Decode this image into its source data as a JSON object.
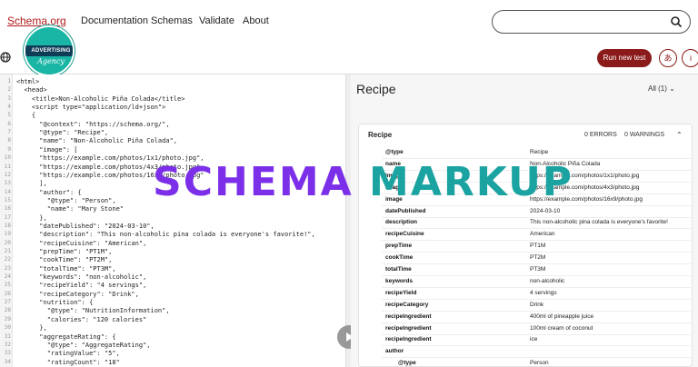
{
  "nav": {
    "logo": "Schema.org",
    "links": [
      "Documentation",
      "Schemas",
      "Validate",
      "About"
    ],
    "search_placeholder": ""
  },
  "badge": {
    "ribbon": "ADVERTISING",
    "script": "Agency"
  },
  "toolbar": {
    "run_label": "Run new test",
    "lang_label": "あ",
    "info_label": "i"
  },
  "editor": {
    "lines": [
      "<html>",
      "  <head>",
      "    <title>Non-Alcoholic Piña Colada</title>",
      "    <script type=\"application/ld+json\">",
      "    {",
      "      \"@context\": \"https://schema.org/\",",
      "      \"@type\": \"Recipe\",",
      "      \"name\": \"Non-Alcoholic Piña Colada\",",
      "      \"image\": [",
      "      \"https://example.com/photos/1x1/photo.jpg\",",
      "      \"https://example.com/photos/4x3/photo.jpg\",",
      "      \"https://example.com/photos/16x9/photo.jpg\"",
      "      ],",
      "      \"author\": {",
      "        \"@type\": \"Person\",",
      "        \"name\": \"Mary Stone\"",
      "      },",
      "      \"datePublished\": \"2024-03-10\",",
      "      \"description\": \"This non-alcoholic pina colada is everyone's favorite!\",",
      "      \"recipeCuisine\": \"American\",",
      "      \"prepTime\": \"PT1M\",",
      "      \"cookTime\": \"PT2M\",",
      "      \"totalTime\": \"PT3M\",",
      "      \"keywords\": \"non-alcoholic\",",
      "      \"recipeYield\": \"4 servings\",",
      "      \"recipeCategory\": \"Drink\",",
      "      \"nutrition\": {",
      "        \"@type\": \"NutritionInformation\",",
      "        \"calories\": \"120 calories\"",
      "      },",
      "      \"aggregateRating\": {",
      "        \"@type\": \"AggregateRating\",",
      "        \"ratingValue\": \"5\",",
      "        \"ratingCount\": \"18\""
    ]
  },
  "result": {
    "title": "Recipe",
    "filter": "All (1)",
    "card_title": "Recipe",
    "errors": "0 ERRORS",
    "warnings": "0 WARNINGS",
    "rows": [
      {
        "k": "@type",
        "v": "Recipe"
      },
      {
        "k": "name",
        "v": "Non-Alcoholic Piña Colada"
      },
      {
        "k": "image",
        "v": "https://example.com/photos/1x1/photo.jpg"
      },
      {
        "k": "image",
        "v": "https://example.com/photos/4x3/photo.jpg"
      },
      {
        "k": "image",
        "v": "https://example.com/photos/16x9/photo.jpg"
      },
      {
        "k": "datePublished",
        "v": "2024-03-10"
      },
      {
        "k": "description",
        "v": "This non-alcoholic pina colada is everyone's favorite!"
      },
      {
        "k": "recipeCuisine",
        "v": "American"
      },
      {
        "k": "prepTime",
        "v": "PT1M"
      },
      {
        "k": "cookTime",
        "v": "PT2M"
      },
      {
        "k": "totalTime",
        "v": "PT3M"
      },
      {
        "k": "keywords",
        "v": "non-alcoholic"
      },
      {
        "k": "recipeYield",
        "v": "4 servings"
      },
      {
        "k": "recipeCategory",
        "v": "Drink"
      },
      {
        "k": "recipeIngredient",
        "v": "400ml of pineapple juice"
      },
      {
        "k": "recipeIngredient",
        "v": "100ml cream of coconut"
      },
      {
        "k": "recipeIngredient",
        "v": "ice"
      },
      {
        "k": "author",
        "v": ""
      },
      {
        "k": "@type",
        "v": "Person"
      }
    ]
  },
  "overlay": {
    "word1": "SCHEMA",
    "word2": "MARKUP"
  },
  "colors": {
    "brand": "#b01a1a",
    "run_button": "#8b1a1a",
    "overlay_purple": "#7b2fe8",
    "overlay_teal": "#1aa3a0"
  }
}
